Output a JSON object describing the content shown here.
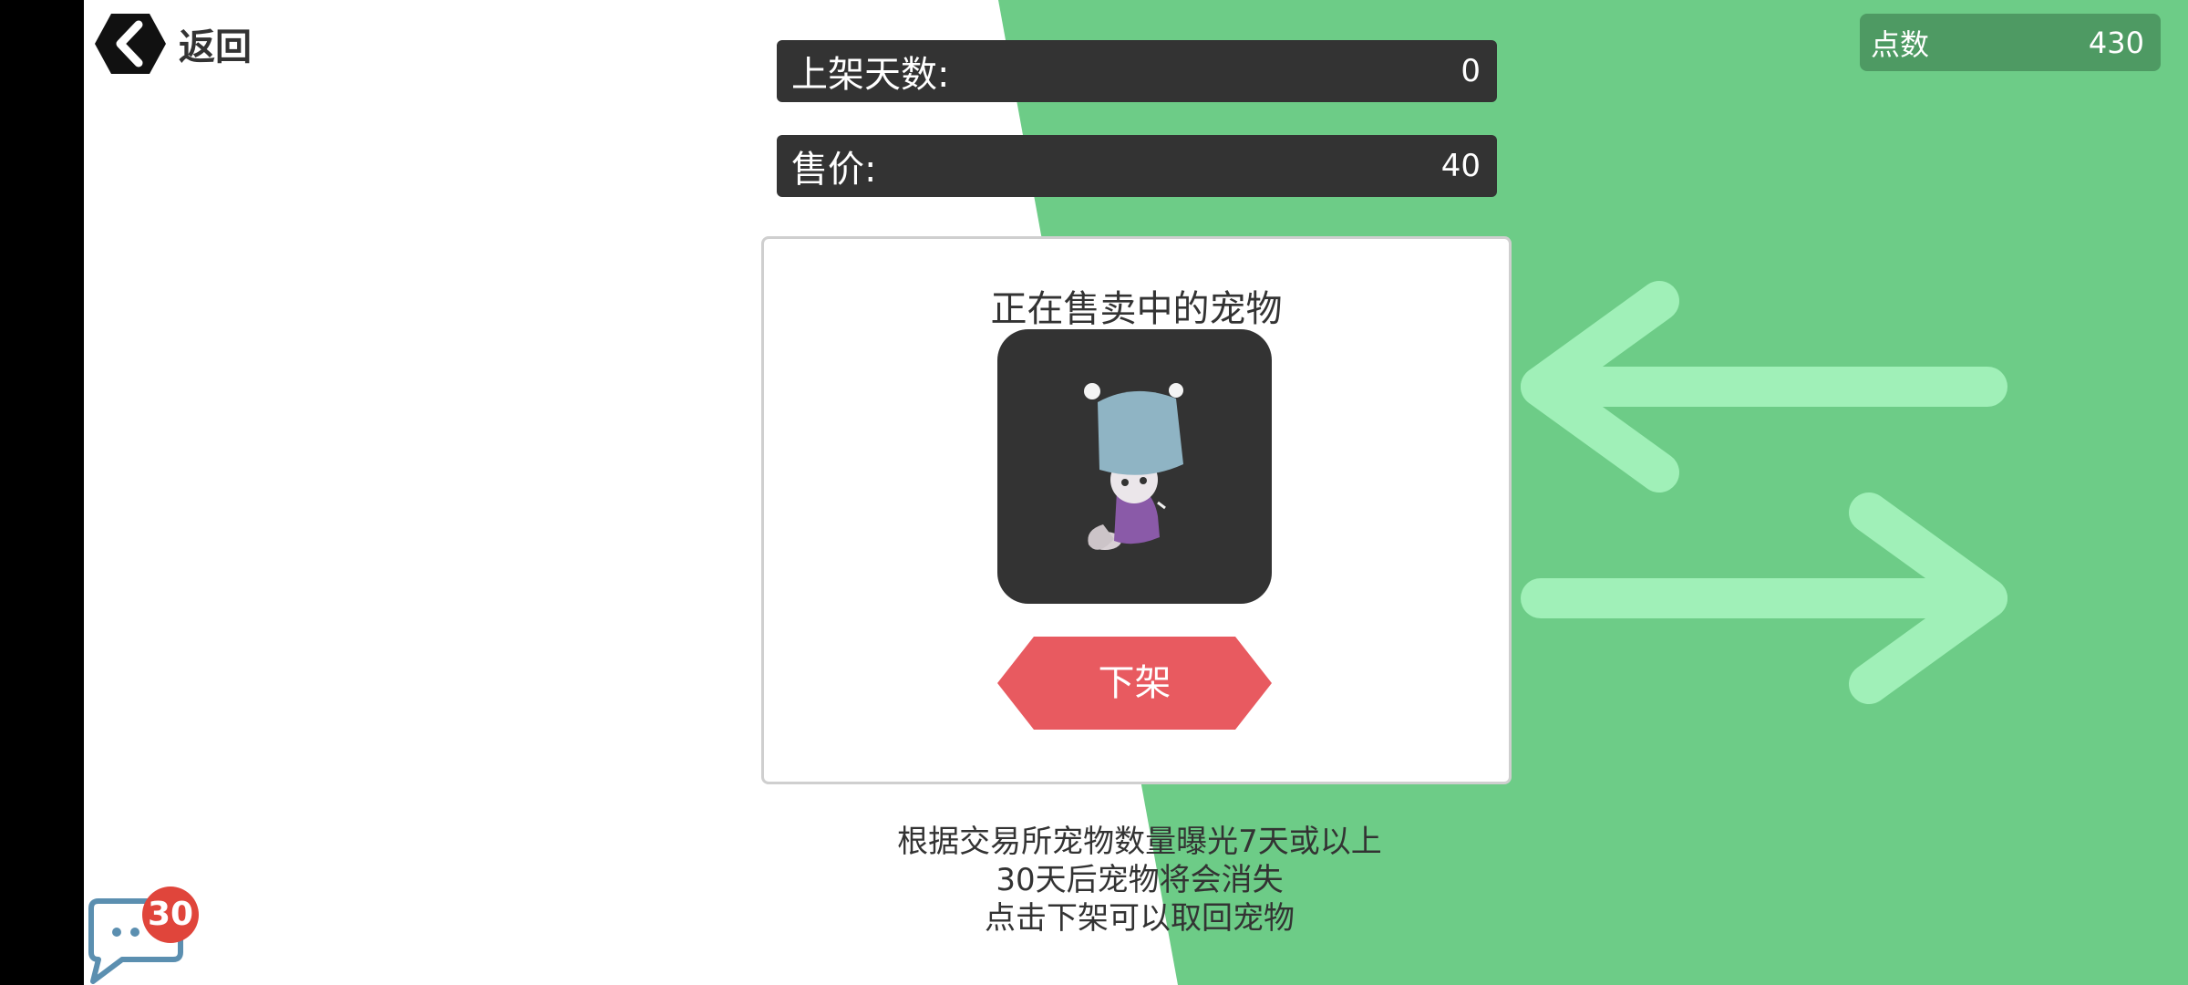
{
  "header": {
    "back_label": "返回",
    "points_label": "点数",
    "points_value": "430"
  },
  "stats": {
    "days_label": "上架天数:",
    "days_value": "0",
    "price_label": "售价:",
    "price_value": "40"
  },
  "panel": {
    "title": "正在售卖中的宠物",
    "delist_label": "下架"
  },
  "info": {
    "lines": [
      "根据交易所宠物数量曝光7天或以上",
      "30天后宠物将会消失",
      "点击下架可以取回宠物"
    ]
  },
  "chat": {
    "unread_count": "30"
  },
  "colors": {
    "accent_green": "#6dcc87",
    "arrow_green": "#a0f0b8",
    "bar_dark": "#333333",
    "delist_red": "#e85a60",
    "badge_red": "#e0453b"
  },
  "icons": {
    "back": "chevron-left-icon",
    "chat": "chat-bubble-icon",
    "background": "swap-arrows-icon"
  }
}
